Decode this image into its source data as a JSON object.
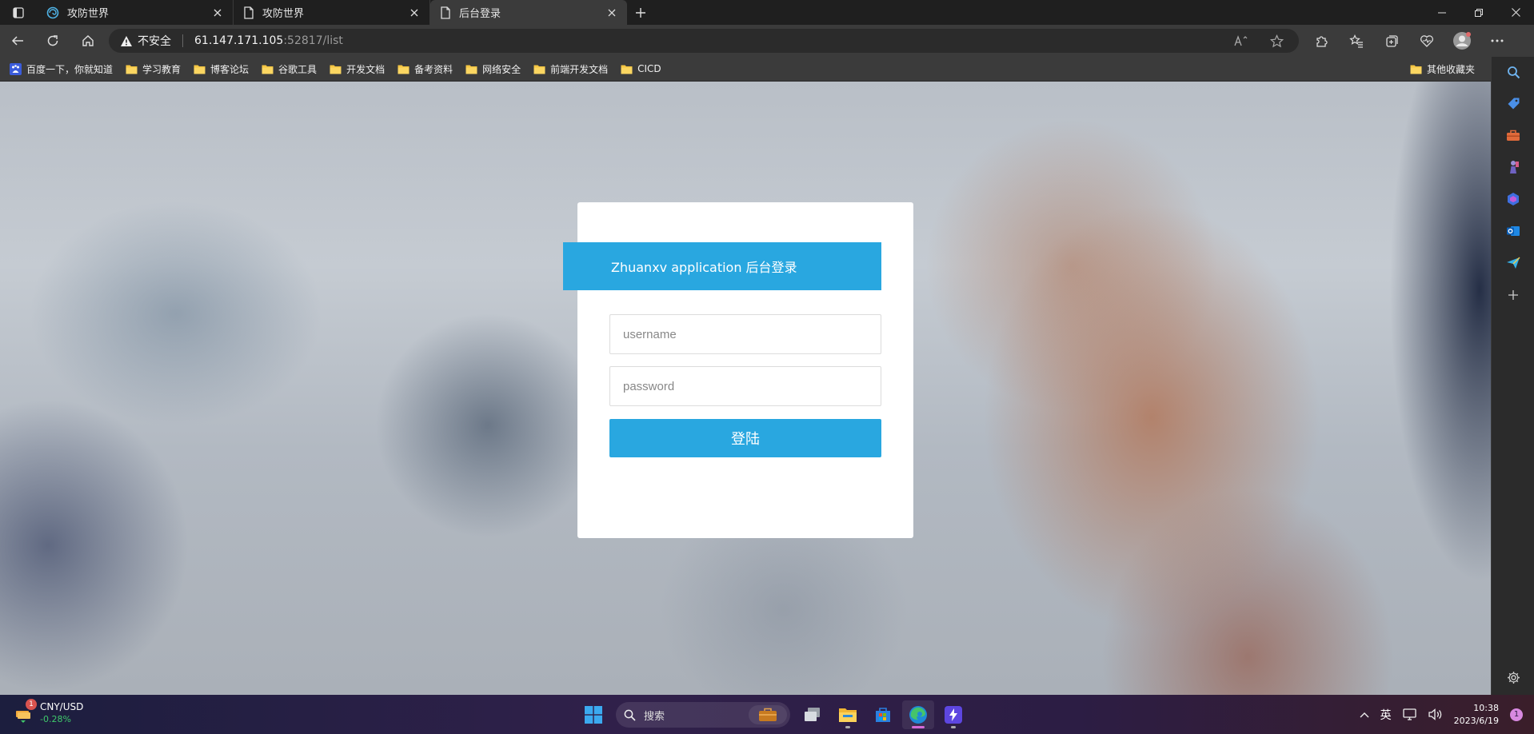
{
  "browser": {
    "tabs": [
      {
        "title": "攻防世界",
        "icon": "globe-swirl-icon",
        "active": false
      },
      {
        "title": "攻防世界",
        "icon": "page-icon",
        "active": false
      },
      {
        "title": "后台登录",
        "icon": "page-icon",
        "active": true
      }
    ],
    "address": {
      "security_label": "不安全",
      "url_host": "61.147.171.105",
      "url_rest": ":52817/list"
    },
    "bookmarks": [
      {
        "label": "百度一下，你就知道",
        "icon": "baidu-icon"
      },
      {
        "label": "学习教育",
        "icon": "folder-icon"
      },
      {
        "label": "博客论坛",
        "icon": "folder-icon"
      },
      {
        "label": "谷歌工具",
        "icon": "folder-icon"
      },
      {
        "label": "开发文档",
        "icon": "folder-icon"
      },
      {
        "label": "备考资料",
        "icon": "folder-icon"
      },
      {
        "label": "网络安全",
        "icon": "folder-icon"
      },
      {
        "label": "前端开发文档",
        "icon": "folder-icon"
      },
      {
        "label": "CICD",
        "icon": "folder-icon"
      }
    ],
    "other_bookmarks": "其他收藏夹"
  },
  "page": {
    "header": "Zhuanxv application 后台登录",
    "username_placeholder": "username",
    "password_placeholder": "password",
    "login_button": "登陆"
  },
  "taskbar": {
    "widget": {
      "name": "CNY/USD",
      "change": "-0.28%",
      "badge": "1"
    },
    "search_label": "搜索",
    "ime": "英",
    "time": "10:38",
    "date": "2023/6/19",
    "notification_count": "1"
  },
  "colors": {
    "accent": "#29a7e0",
    "chrome_dark": "#1f1f1f",
    "chrome": "#3b3b3b",
    "positive": "#3fc96b"
  }
}
